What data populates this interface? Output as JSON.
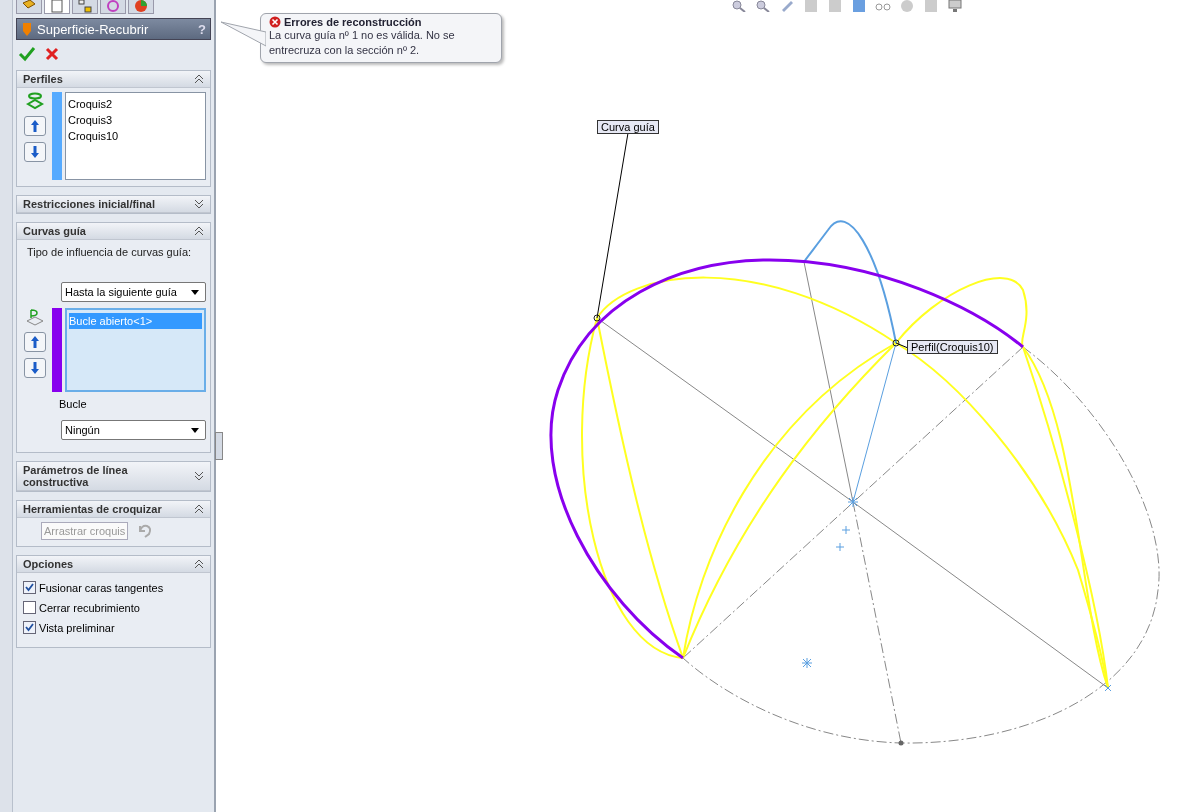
{
  "panel_tabs": [
    {
      "selected": false
    },
    {
      "selected": true
    },
    {
      "selected": false
    },
    {
      "selected": false
    },
    {
      "selected": false
    }
  ],
  "property_manager": {
    "title": "Superficie-Recubrir",
    "help": "?"
  },
  "groups": [
    {
      "kind": "profiles",
      "title": "Perfiles",
      "expanded": true,
      "color": "#55aaff",
      "items": [
        "Croquis2",
        "Croquis3",
        "Croquis10"
      ]
    },
    {
      "title": "Restricciones inicial/final",
      "expanded": false
    },
    {
      "kind": "guides",
      "title": "Curvas guía",
      "expanded": true,
      "label": "Tipo de influencia de curvas guía:",
      "influence": "Hasta la siguiente guía",
      "color": "#8800ee",
      "items": [
        {
          "label": "Bucle abierto<1>",
          "selected": true
        }
      ],
      "sublabel": "Bucle",
      "tangency": "Ningún"
    },
    {
      "title": "Parámetros de línea constructiva",
      "expanded": false
    },
    {
      "kind": "sketch_tools",
      "title": "Herramientas de croquizar",
      "expanded": true,
      "button": {
        "label": "Arrastrar croquis",
        "disabled": true
      }
    },
    {
      "kind": "options",
      "title": "Opciones",
      "expanded": true,
      "items": [
        {
          "label": "Fusionar caras tangentes",
          "checked": true
        },
        {
          "label": "Cerrar recubrimiento",
          "checked": false
        },
        {
          "label": "Vista preliminar",
          "checked": true
        }
      ]
    }
  ],
  "error_tooltip": {
    "title": "Errores de reconstrucción",
    "message": "La curva guía nº 1 no es válida. No se entrecruza con la sección nº 2."
  },
  "viewport_labels": [
    {
      "text": "Curva guía"
    },
    {
      "text": "Perfil(Croquis10)"
    }
  ]
}
